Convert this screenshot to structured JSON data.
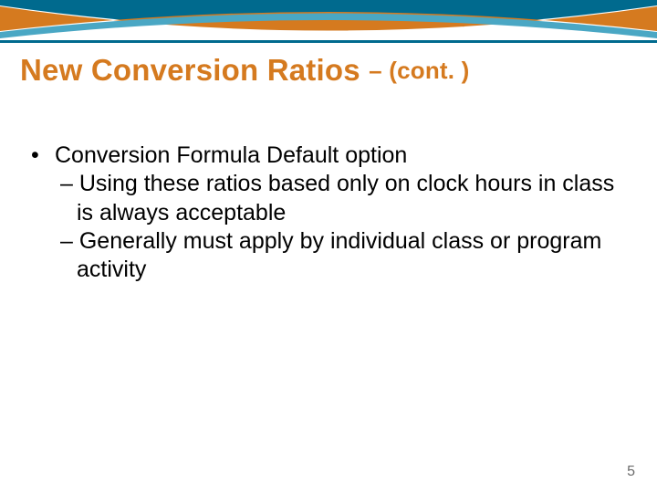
{
  "title": {
    "main": "New Conversion Ratios ",
    "cont": "– (cont. )"
  },
  "bullet": {
    "mark": "•",
    "text": "Conversion Formula Default option"
  },
  "sub1": "– Using these ratios based only on clock hours in class is always acceptable",
  "sub2": "– Generally must apply by individual class or program activity",
  "page": "5"
}
